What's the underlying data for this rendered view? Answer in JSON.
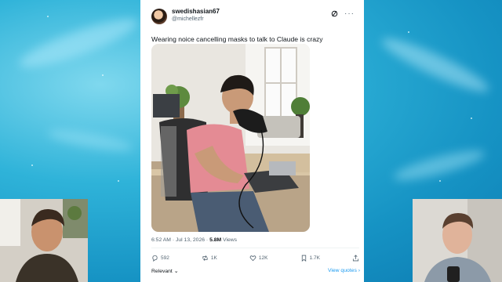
{
  "tweet": {
    "display_name": "swedishasian67",
    "handle": "@michellezfr",
    "text": "Wearing noice cancelling masks to talk to Claude is crazy",
    "time": "6:52 AM · Jul 13, 2026 · ",
    "views_count": "5.8M",
    "views_label": " Views",
    "actions": {
      "replies": "592",
      "reposts": "1K",
      "likes": "12K",
      "bookmarks": "1.7K"
    },
    "sort_label": "Relevant",
    "view_quotes": "View quotes"
  },
  "icons": [
    "grok-icon",
    "more-icon",
    "reply-icon",
    "repost-icon",
    "like-icon",
    "bookmark-icon",
    "share-icon"
  ],
  "colors": {
    "accent": "#1d9bf0",
    "text": "#0f1419",
    "muted": "#536471",
    "background": "#2fb3d9"
  }
}
